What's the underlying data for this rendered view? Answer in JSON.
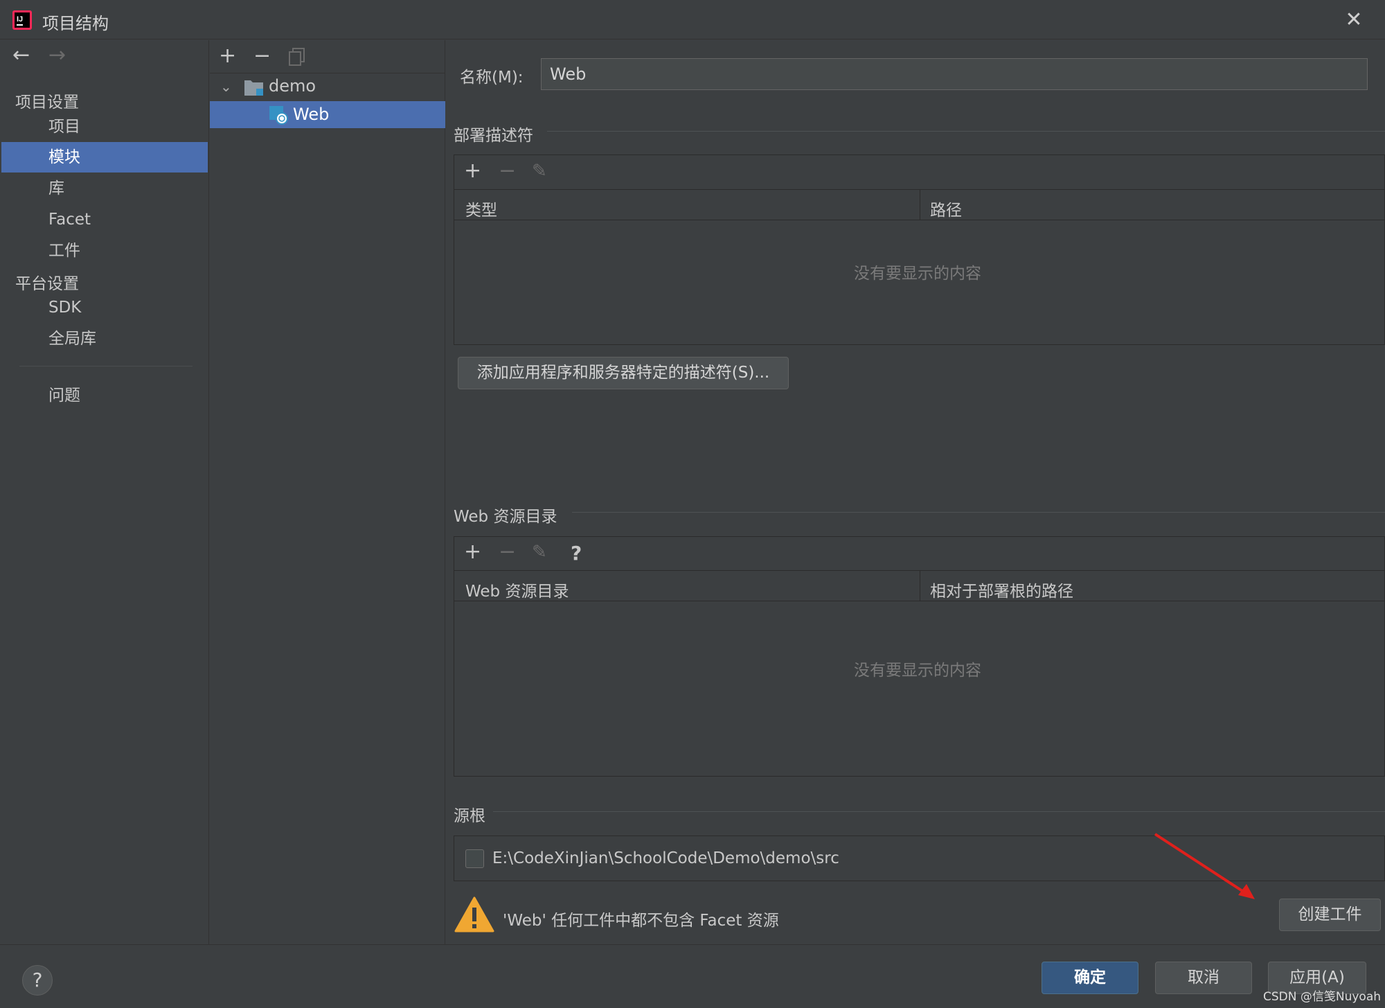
{
  "window": {
    "title": "项目结构",
    "close_icon": "close-icon",
    "logo_icon": "intellij-logo-icon"
  },
  "sidebar": {
    "back_icon": "arrow-left-icon",
    "forward_icon": "arrow-right-icon",
    "project_settings_heading": "项目设置",
    "platform_settings_heading": "平台设置",
    "items": [
      {
        "label": "项目"
      },
      {
        "label": "模块"
      },
      {
        "label": "库"
      },
      {
        "label": "Facet"
      },
      {
        "label": "工件"
      },
      {
        "label": "SDK"
      },
      {
        "label": "全局库"
      },
      {
        "label": "问题"
      }
    ],
    "selected": "模块"
  },
  "tree": {
    "toolbar": {
      "add": "+",
      "remove": "−",
      "copy_icon": "copy-icon"
    },
    "root": {
      "label": "demo",
      "icon": "folder-icon",
      "expand_icon": "chevron-down-icon"
    },
    "child": {
      "label": "Web",
      "icon": "web-facet-icon"
    }
  },
  "main": {
    "name_label": "名称(M):",
    "name_value": "Web",
    "deploy": {
      "title": "部署描述符",
      "columns": [
        "类型",
        "路径"
      ],
      "empty": "没有要显示的内容",
      "add_button": "添加应用程序和服务器特定的描述符(S)..."
    },
    "webres": {
      "title": "Web 资源目录",
      "columns": [
        "Web 资源目录",
        "相对于部署根的路径"
      ],
      "empty": "没有要显示的内容",
      "help": "?"
    },
    "source": {
      "title": "源根",
      "path": "E:\\CodeXinJian\\SchoolCode\\Demo\\demo\\src",
      "checked": false
    },
    "warning": {
      "text": "'Web' 任何工件中都不包含 Facet 资源",
      "icon": "warning-icon",
      "create_button": "创建工件"
    }
  },
  "footer": {
    "help": "?",
    "ok": "确定",
    "cancel": "取消",
    "apply": "应用(A)"
  },
  "watermark": "CSDN @信笺Nuyoah",
  "colors": {
    "background": "#3c3f41",
    "selection": "#4b6eaf",
    "primary_button": "#365880",
    "warning": "#f0a732",
    "annotation_arrow": "#e0201c"
  }
}
